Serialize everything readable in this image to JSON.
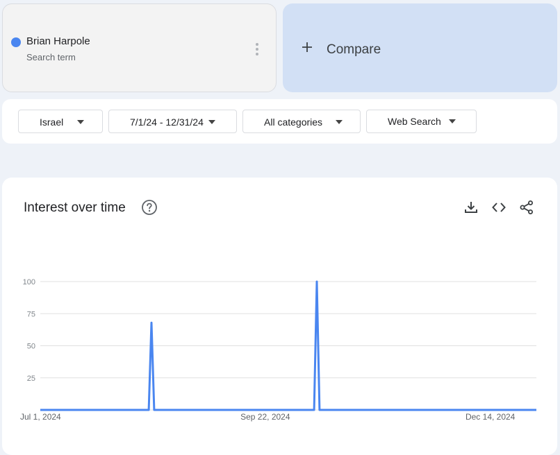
{
  "term": {
    "name": "Brian Harpole",
    "subtitle": "Search term",
    "color": "#4a86f0"
  },
  "compare": {
    "label": "Compare",
    "icon": "plus-icon"
  },
  "filters": {
    "region": "Israel",
    "date_range": "7/1/24 - 12/31/24",
    "category": "All categories",
    "search_type": "Web Search"
  },
  "chart_card": {
    "title": "Interest over time",
    "icons": [
      "help-icon",
      "download-icon",
      "embed-code-icon",
      "share-icon"
    ]
  },
  "chart_data": {
    "type": "line",
    "title": "Interest over time",
    "xlabel": "",
    "ylabel": "",
    "ylim": [
      0,
      100
    ],
    "yticks": [
      25,
      50,
      75,
      100
    ],
    "y_tick_labels": [
      "25",
      "50",
      "75",
      "100"
    ],
    "x_tick_labels": [
      "Jul 1, 2024",
      "Sep 22, 2024",
      "Dec 14, 2024"
    ],
    "x_tick_dates": [
      "2024-07-01",
      "2024-09-22",
      "2024-12-14"
    ],
    "x_range": [
      "2024-07-01",
      "2024-12-31"
    ],
    "grid": true,
    "series": [
      {
        "name": "Brian Harpole",
        "color": "#4a86f0",
        "x": [
          "2024-07-01",
          "2024-08-10",
          "2024-08-11",
          "2024-08-12",
          "2024-10-10",
          "2024-10-11",
          "2024-10-12",
          "2024-12-31"
        ],
        "values": [
          0,
          0,
          68,
          0,
          0,
          100,
          0,
          0
        ]
      }
    ]
  }
}
